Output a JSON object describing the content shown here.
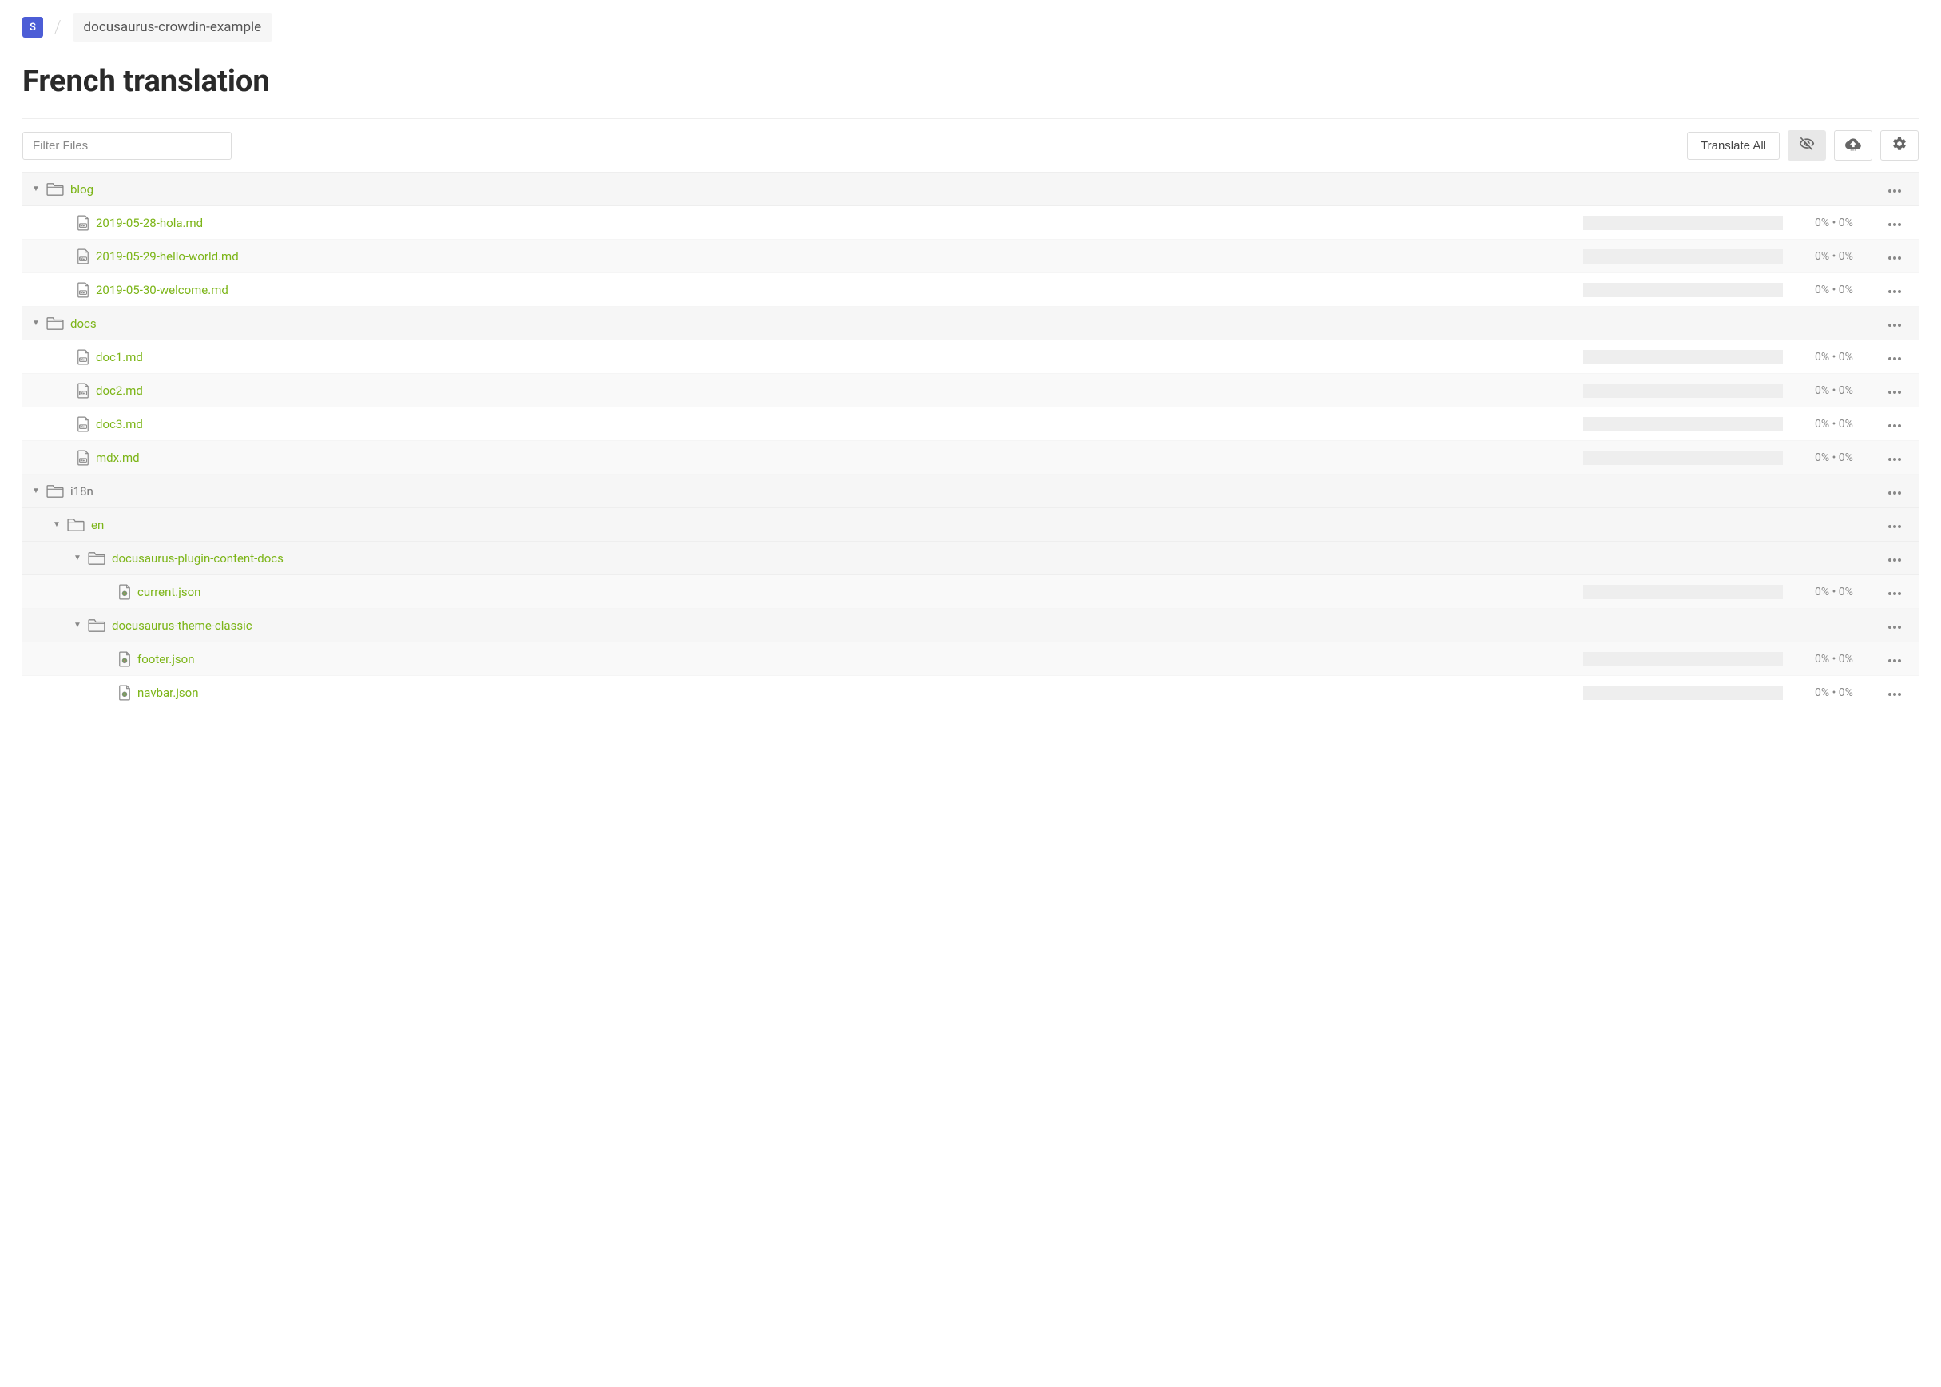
{
  "breadcrumb": {
    "icon": "S",
    "project": "docusaurus-crowdin-example"
  },
  "page": {
    "title": "French translation"
  },
  "toolbar": {
    "filter_placeholder": "Filter Files",
    "translate_all": "Translate All"
  },
  "tree": [
    {
      "type": "folder",
      "depth": 0,
      "name": "blog",
      "expanded": true,
      "alt": false
    },
    {
      "type": "file",
      "depth": 1,
      "name": "2019-05-28-hola.md",
      "filetype": "md",
      "progress": "0% • 0%",
      "alt": false
    },
    {
      "type": "file",
      "depth": 1,
      "name": "2019-05-29-hello-world.md",
      "filetype": "md",
      "progress": "0% • 0%",
      "alt": true
    },
    {
      "type": "file",
      "depth": 1,
      "name": "2019-05-30-welcome.md",
      "filetype": "md",
      "progress": "0% • 0%",
      "alt": false
    },
    {
      "type": "folder",
      "depth": 0,
      "name": "docs",
      "expanded": true,
      "alt": false
    },
    {
      "type": "file",
      "depth": 1,
      "name": "doc1.md",
      "filetype": "md",
      "progress": "0% • 0%",
      "alt": false
    },
    {
      "type": "file",
      "depth": 1,
      "name": "doc2.md",
      "filetype": "md",
      "progress": "0% • 0%",
      "alt": true
    },
    {
      "type": "file",
      "depth": 1,
      "name": "doc3.md",
      "filetype": "md",
      "progress": "0% • 0%",
      "alt": false
    },
    {
      "type": "file",
      "depth": 1,
      "name": "mdx.md",
      "filetype": "md",
      "progress": "0% • 0%",
      "alt": true
    },
    {
      "type": "folder",
      "depth": 0,
      "name": "i18n",
      "expanded": true,
      "neutral": true,
      "alt": false
    },
    {
      "type": "folder",
      "depth": 1,
      "name": "en",
      "expanded": true,
      "alt": false
    },
    {
      "type": "folder",
      "depth": 2,
      "name": "docusaurus-plugin-content-docs",
      "expanded": true,
      "alt": false
    },
    {
      "type": "file",
      "depth": 3,
      "name": "current.json",
      "filetype": "json",
      "progress": "0% • 0%",
      "alt": true
    },
    {
      "type": "folder",
      "depth": 2,
      "name": "docusaurus-theme-classic",
      "expanded": true,
      "alt": false
    },
    {
      "type": "file",
      "depth": 3,
      "name": "footer.json",
      "filetype": "json",
      "progress": "0% • 0%",
      "alt": true
    },
    {
      "type": "file",
      "depth": 3,
      "name": "navbar.json",
      "filetype": "json",
      "progress": "0% • 0%",
      "alt": false
    }
  ]
}
